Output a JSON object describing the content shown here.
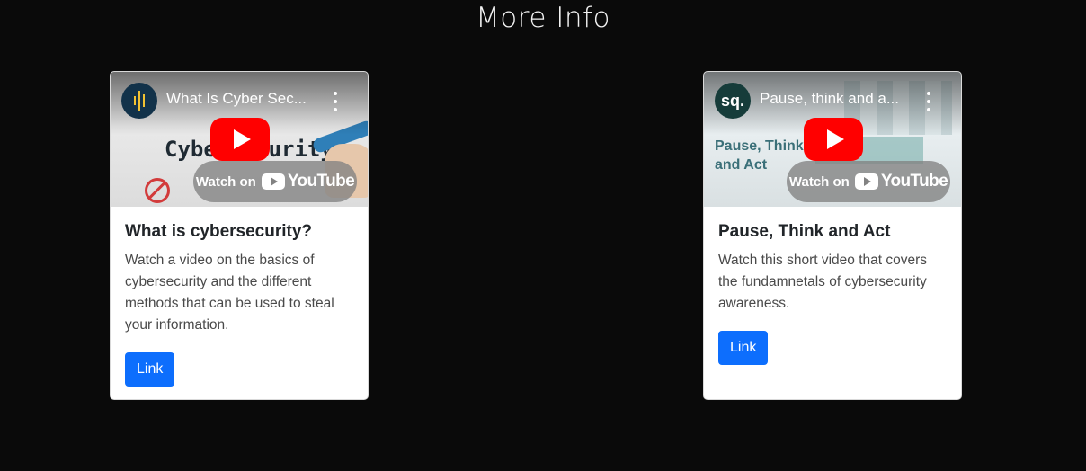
{
  "section": {
    "title": "More Info"
  },
  "cards": [
    {
      "video": {
        "title": "What Is Cyber Sec...",
        "watch_on": "Watch on",
        "platform": "YouTube",
        "thumbnail_text": "Cybersecurity?",
        "avatar_icon": "channel-logo-bars"
      },
      "title": "What is cybersecurity?",
      "text": "Watch a video on the basics of cybersecurity and the different methods that can be used to steal your information.",
      "button": "Link"
    },
    {
      "video": {
        "title": "Pause, think and a...",
        "watch_on": "Watch on",
        "platform": "YouTube",
        "thumbnail_text": "Pause, Think and Act",
        "avatar_text": "sq."
      },
      "title": "Pause, Think and Act",
      "text": "Watch this short video that covers the fundamnetals of cybersecurity awareness.",
      "button": "Link"
    }
  ],
  "colors": {
    "background": "#0a0a0a",
    "button": "#0d6efd",
    "play_button": "#ff0000"
  }
}
